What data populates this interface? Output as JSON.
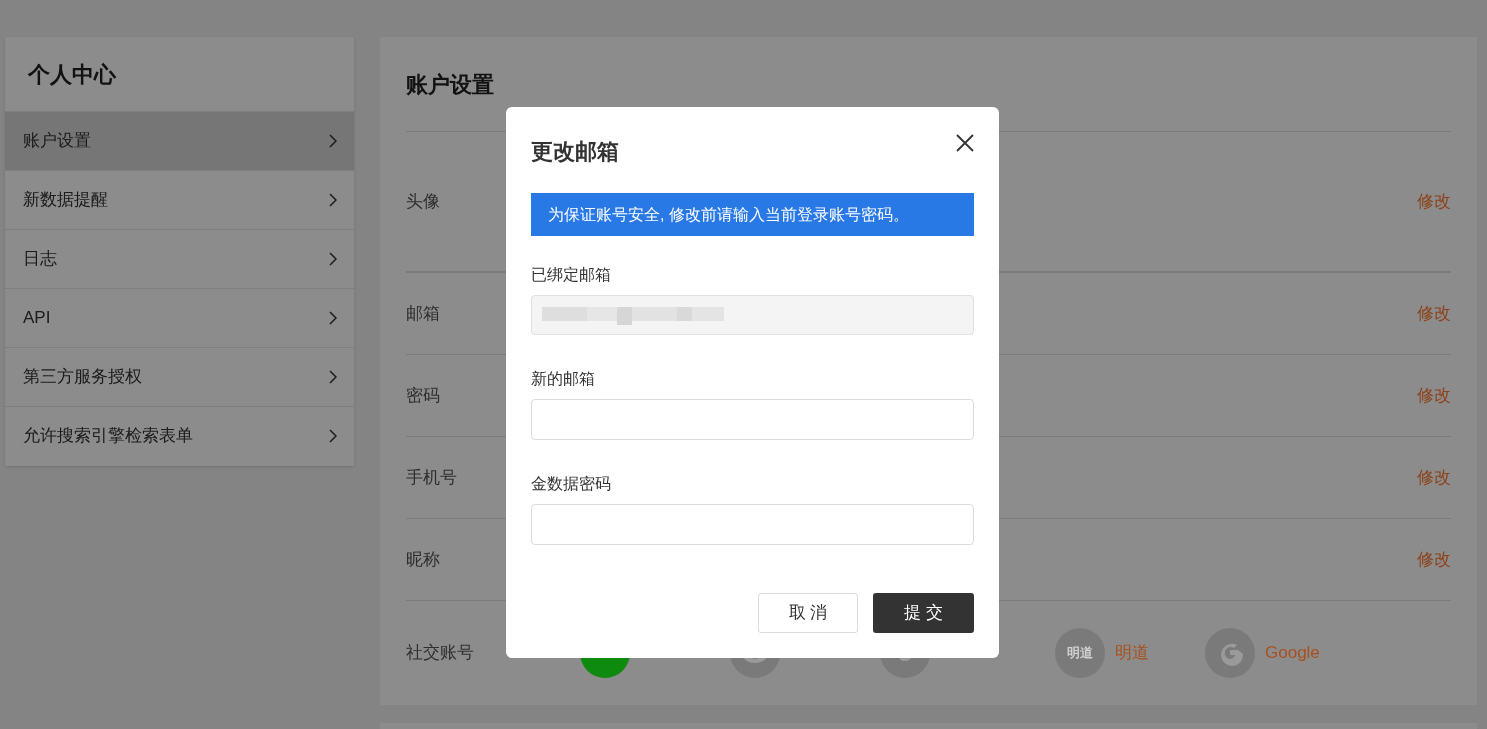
{
  "sidebar": {
    "title": "个人中心",
    "items": [
      {
        "label": "账户设置",
        "selected": true
      },
      {
        "label": "新数据提醒",
        "selected": false
      },
      {
        "label": "日志",
        "selected": false
      },
      {
        "label": "API",
        "selected": false
      },
      {
        "label": "第三方服务授权",
        "selected": false
      },
      {
        "label": "允许搜索引擎检索表单",
        "selected": false
      }
    ]
  },
  "main": {
    "title": "账户设置",
    "rows": [
      {
        "kind": "avatar",
        "label": "头像",
        "action": "修改"
      },
      {
        "kind": "field",
        "label": "邮箱",
        "action": "修改"
      },
      {
        "kind": "field",
        "label": "密码",
        "action": "修改"
      },
      {
        "kind": "field",
        "label": "手机号",
        "action": "修改"
      },
      {
        "kind": "field",
        "label": "昵称",
        "action": "修改"
      }
    ],
    "social": {
      "label": "社交账号",
      "accounts": [
        {
          "kind": "wechat",
          "color": "#0e8a0e"
        },
        {
          "kind": "weibo",
          "color": "#7a7a7a"
        },
        {
          "kind": "qq",
          "color": "#7a7a7a"
        },
        {
          "kind": "mingdao",
          "name": "明道",
          "icon_text": "明道",
          "color": "#7a7a7a"
        },
        {
          "kind": "google",
          "name": "Google",
          "color": "#7a7a7a"
        }
      ]
    }
  },
  "dialog": {
    "title": "更改邮箱",
    "notice": "为保证账号安全, 修改前请输入当前登录账号密码。",
    "fields": [
      {
        "kind": "redacted",
        "label": "已绑定邮箱"
      },
      {
        "kind": "input",
        "label": "新的邮箱"
      },
      {
        "kind": "input",
        "label": "金数据密码"
      }
    ],
    "buttons": [
      {
        "kind": "secondary",
        "label": "取 消"
      },
      {
        "kind": "primary",
        "label": "提 交"
      }
    ]
  }
}
